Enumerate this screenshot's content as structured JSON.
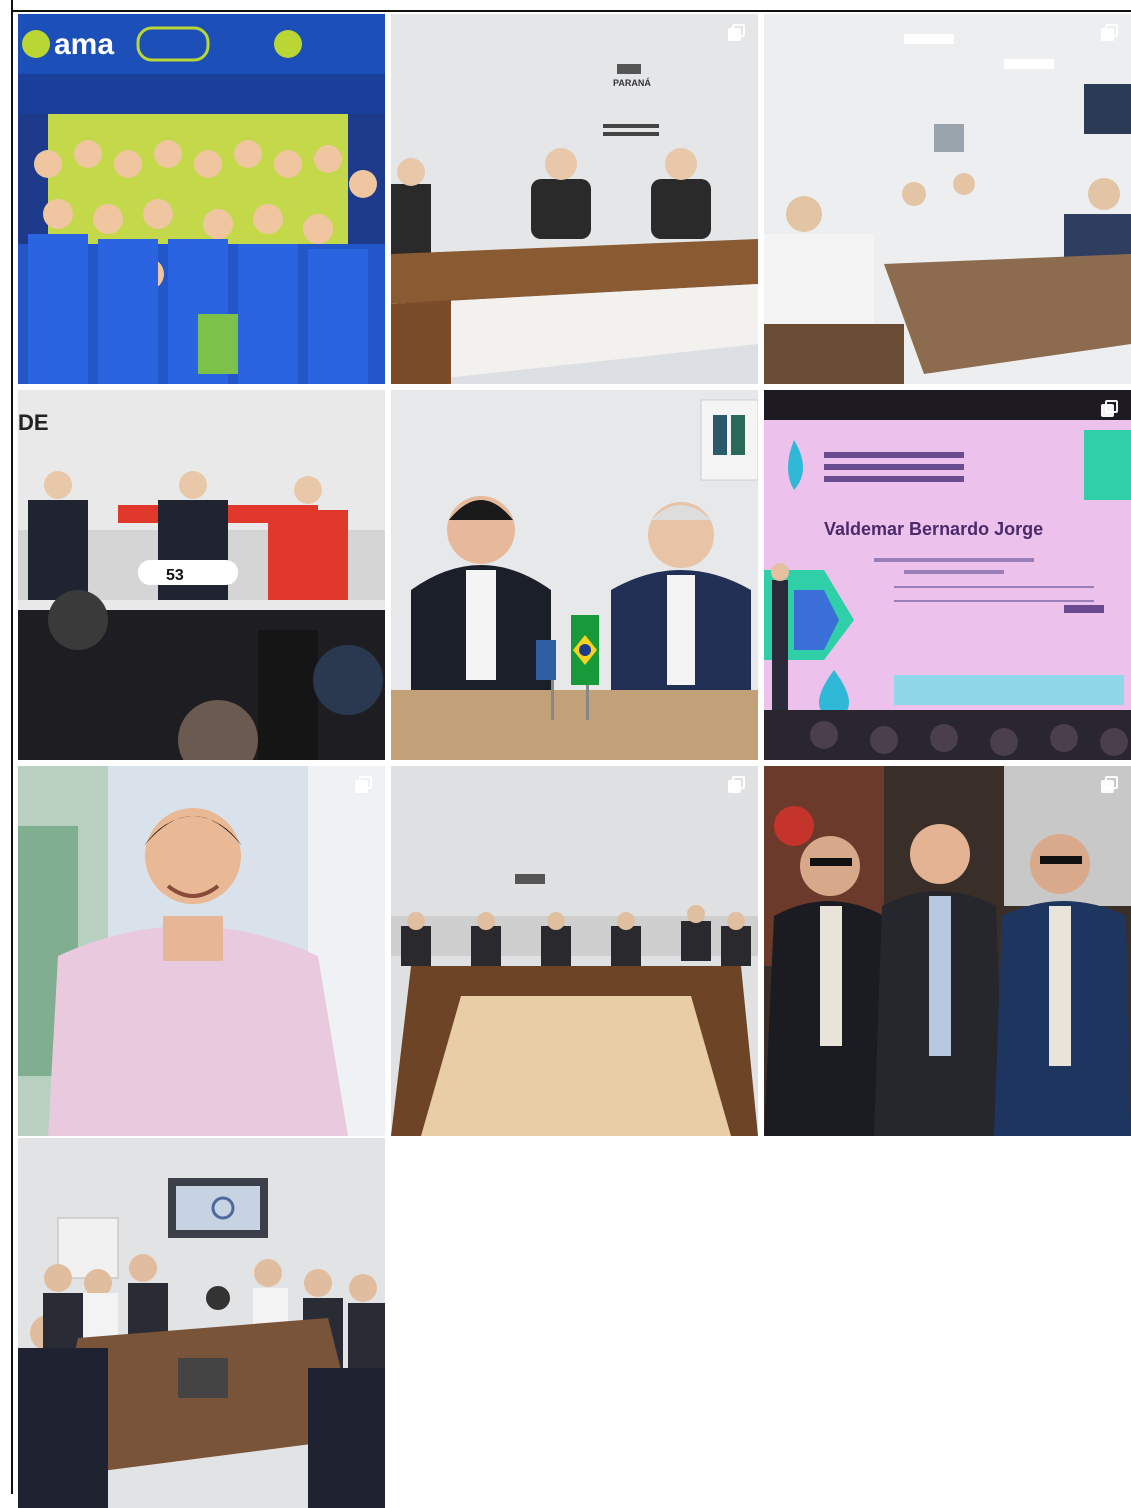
{
  "grid": {
    "posts": [
      {
        "id": "post-1",
        "brand_text": "ama",
        "multi": false
      },
      {
        "id": "post-2",
        "wall_text": "PARANÁ",
        "multi": true
      },
      {
        "id": "post-3",
        "multi": true
      },
      {
        "id": "post-4",
        "logo_text": "DE",
        "stand_text": "53",
        "multi": false
      },
      {
        "id": "post-5",
        "multi": false
      },
      {
        "id": "post-6",
        "screen_name": "Valdemar Bernardo Jorge",
        "multi": true
      },
      {
        "id": "post-7",
        "multi": true
      },
      {
        "id": "post-8",
        "multi": true
      },
      {
        "id": "post-9",
        "multi": true
      },
      {
        "id": "post-10",
        "multi": false
      }
    ]
  },
  "colors": {
    "ama_blue": "#1c4fb8",
    "ama_green": "#b9d634",
    "wall_light": "#dcdfe3",
    "table_wood": "#7a4c2a",
    "screen_pink": "#e8b8e8",
    "screen_teal": "#2fcfa8",
    "lide_red": "#e0392c"
  },
  "icons": {
    "multi_post": "carousel-icon"
  }
}
